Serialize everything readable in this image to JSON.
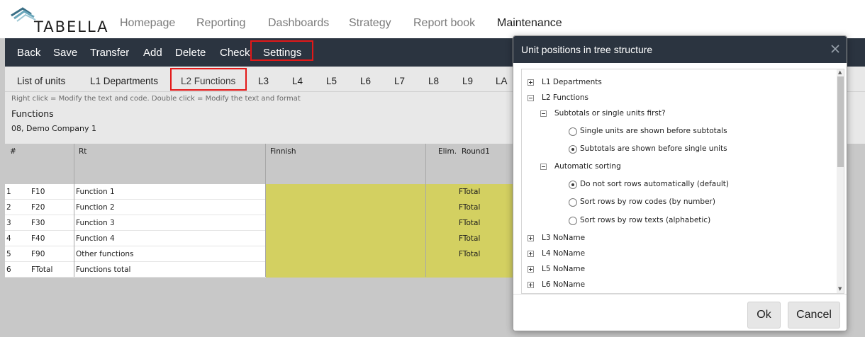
{
  "brand": "TABELLA",
  "nav": [
    "Homepage",
    "Reporting",
    "Dashboards",
    "Strategy",
    "Report book",
    "Maintenance"
  ],
  "toolbar": [
    "Back",
    "Save",
    "Transfer",
    "Add",
    "Delete",
    "Check",
    "Settings"
  ],
  "tabs": [
    "List of units",
    "L1 Departments",
    "L2 Functions",
    "L3",
    "L4",
    "L5",
    "L6",
    "L7",
    "L8",
    "L9",
    "LA"
  ],
  "info": {
    "hint": "Right click = Modify the text and code. Double click = Modify the text and format",
    "title": "Functions",
    "company": "08, Demo Company 1"
  },
  "grid": {
    "headers": [
      "#",
      "Rt",
      "Finnish",
      "Elim.",
      "Round1"
    ],
    "rows": [
      [
        "1",
        "F10",
        "Function 1",
        "FTotal"
      ],
      [
        "2",
        "F20",
        "Function 2",
        "FTotal"
      ],
      [
        "3",
        "F30",
        "Function 3",
        "FTotal"
      ],
      [
        "4",
        "F40",
        "Function 4",
        "FTotal"
      ],
      [
        "5",
        "F90",
        "Other functions",
        "FTotal"
      ],
      [
        "6",
        "FTotal",
        "Functions total",
        ""
      ]
    ]
  },
  "dialog": {
    "title": "Unit positions in tree structure",
    "tree": {
      "l1": "L1 Departments",
      "l2": "L2 Functions",
      "subtotals_group": "Subtotals or single units first?",
      "subtotals_options": [
        "Single units are shown before subtotals",
        "Subtotals are shown before single units"
      ],
      "subtotals_selected": 1,
      "sorting_group": "Automatic sorting",
      "sorting_options": [
        "Do not sort rows automatically (default)",
        "Sort rows by row codes (by number)",
        "Sort rows by row texts (alphabetic)"
      ],
      "sorting_selected": 0,
      "rest": [
        "L3 NoName",
        "L4 NoName",
        "L5 NoName",
        "L6 NoName"
      ]
    },
    "ok": "Ok",
    "cancel": "Cancel"
  },
  "colors": {
    "toolbar_bg": "#2b3440",
    "highlight_border": "#e31818",
    "cell_yellow": "#d3d061"
  }
}
